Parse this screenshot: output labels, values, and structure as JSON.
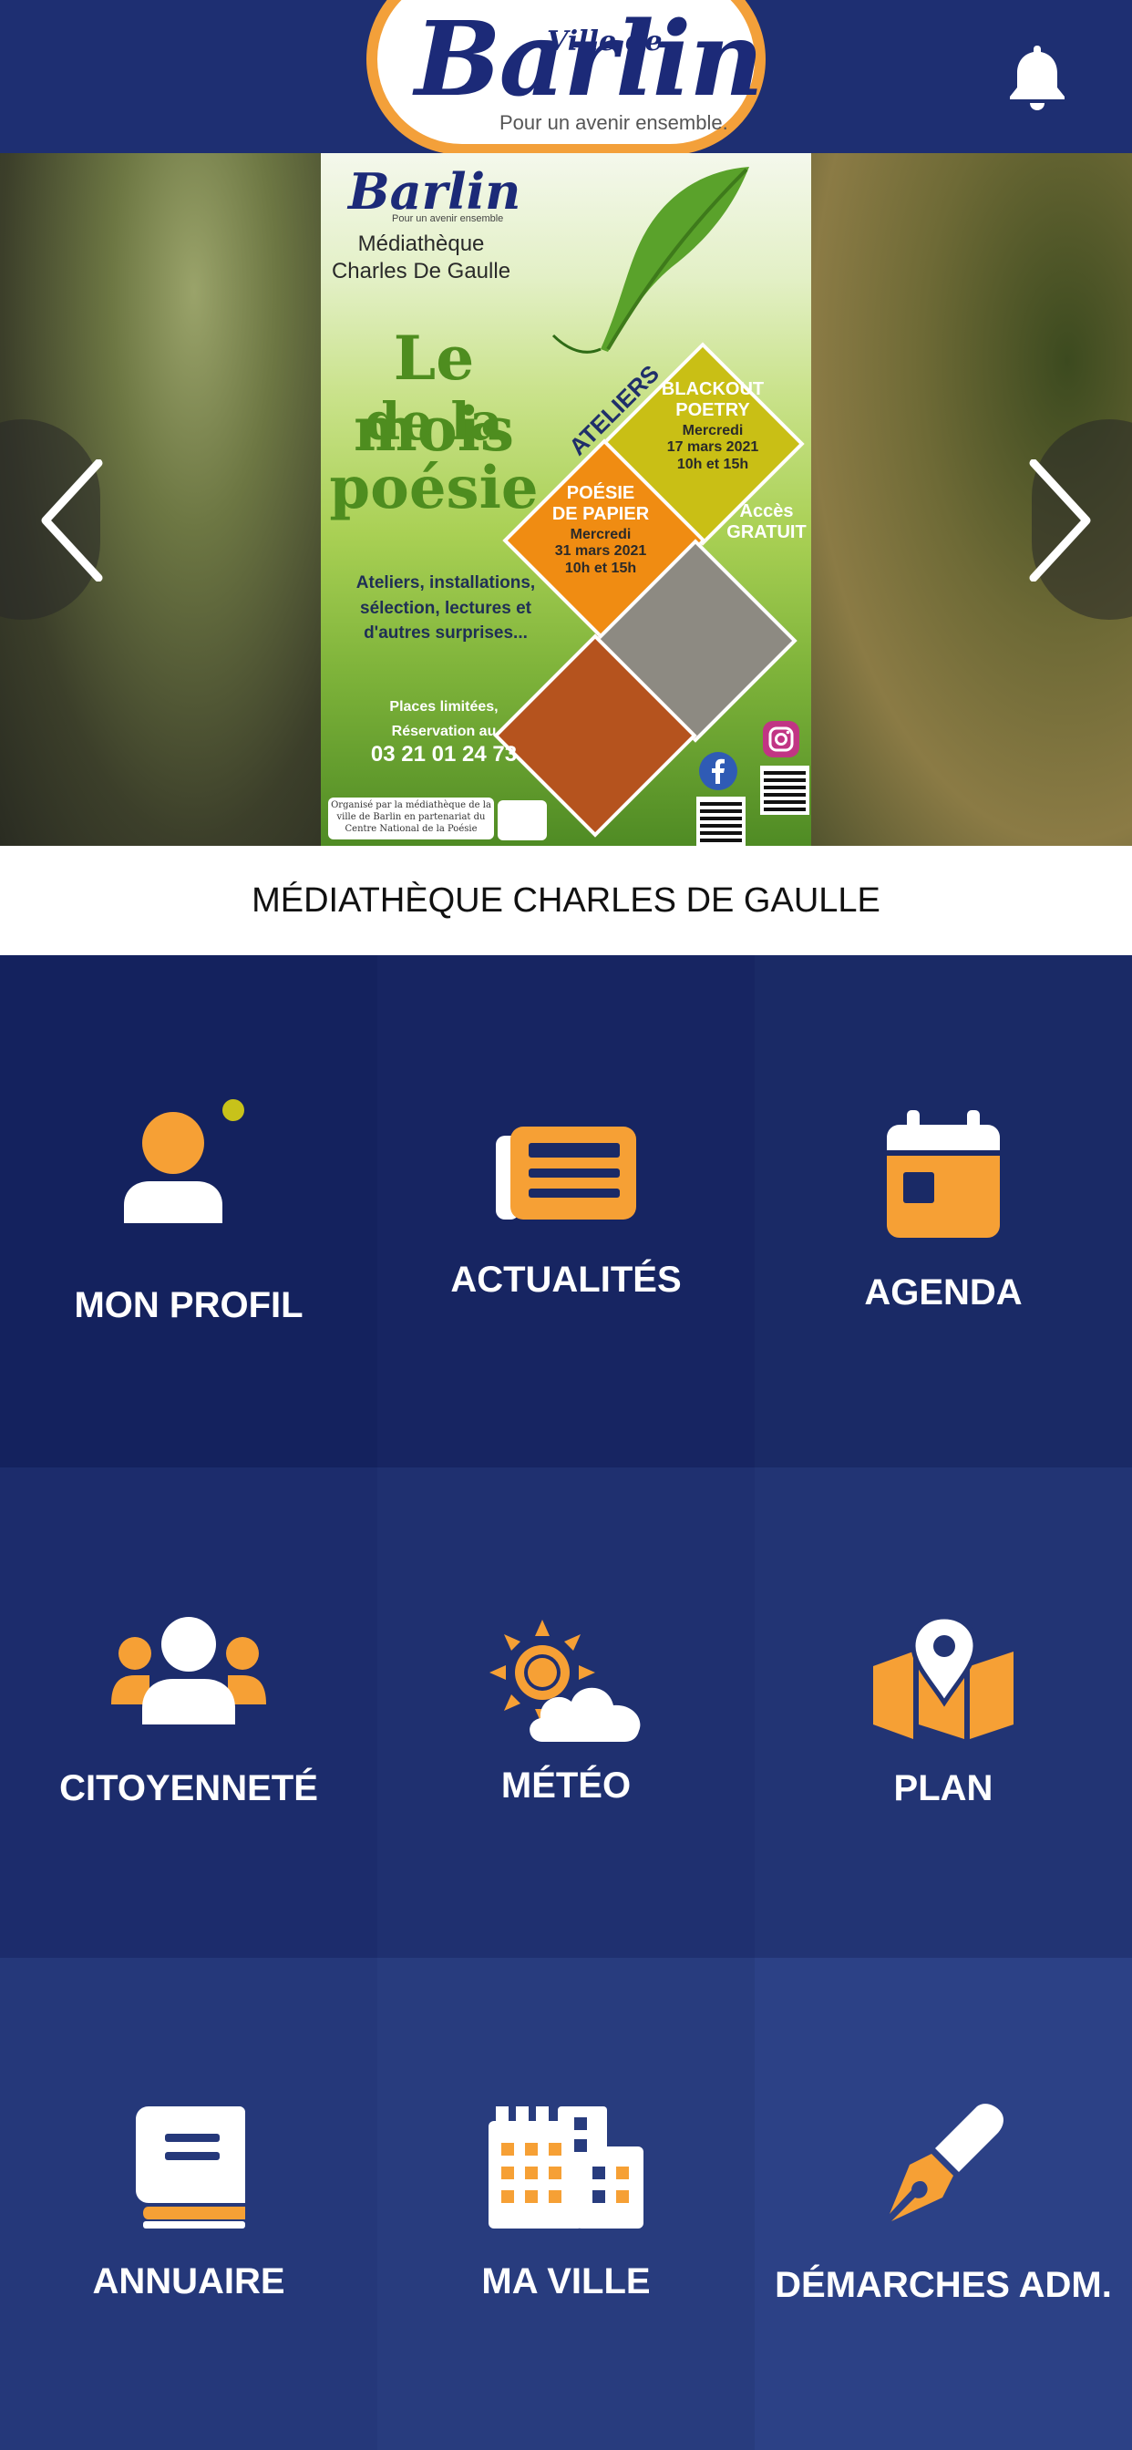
{
  "header": {
    "logo": {
      "ville_de": "Ville de",
      "name": "Barlin",
      "tagline": "Pour un avenir ensemble."
    },
    "notifications_icon": "bell-icon"
  },
  "carousel": {
    "poster": {
      "logo_name": "Barlin",
      "logo_tagline": "Pour un avenir ensemble",
      "venue_line1": "Médiathèque",
      "venue_line2": "Charles De Gaulle",
      "title_line1": "Le mois",
      "title_line2": "de la",
      "title_line3": "poésie",
      "ateliers": "ATELIERS",
      "event1": {
        "line1": "BLACKOUT",
        "line2": "POETRY",
        "line3": "Mercredi",
        "line4": "17 mars 2021",
        "line5": "10h et 15h"
      },
      "event2": {
        "line1": "POÉSIE",
        "line2": "DE PAPIER",
        "line3": "Mercredi",
        "line4": "31 mars 2021",
        "line5": "10h et 15h"
      },
      "access_line1": "Accès",
      "access_line2": "GRATUIT",
      "description": "Ateliers, installations, sélection, lectures et d'autres surprises...",
      "places_line1": "Places limitées,",
      "places_line2": "Réservation au",
      "phone": "03 21 01 24 73",
      "organizer": "Organisé par la médiathèque de la ville de Barlin en partenariat du Centre National de la Poésie"
    },
    "prev_icon": "chevron-left-icon",
    "next_icon": "chevron-right-icon",
    "caption": "MÉDIATHÈQUE CHARLES DE GAULLE"
  },
  "menu": {
    "tiles": [
      {
        "label": "MON PROFIL",
        "icon": "profile-icon"
      },
      {
        "label": "ACTUALITÉS",
        "icon": "newspaper-icon"
      },
      {
        "label": "AGENDA",
        "icon": "calendar-icon"
      },
      {
        "label": "CITOYENNETÉ",
        "icon": "users-icon"
      },
      {
        "label": "MÉTÉO",
        "icon": "weather-icon"
      },
      {
        "label": "PLAN",
        "icon": "map-icon"
      },
      {
        "label": "ANNUAIRE",
        "icon": "book-icon"
      },
      {
        "label": "MA VILLE",
        "icon": "city-icon"
      },
      {
        "label": "DÉMARCHES ADM.",
        "icon": "pen-icon"
      }
    ]
  },
  "colors": {
    "header_bg": "#1e2f72",
    "accent_orange": "#f6a035",
    "status_dot": "#c8c21a",
    "row1_tiles": [
      "#14225e",
      "#172562",
      "#1a2a66"
    ],
    "row2_tiles": [
      "#1c2c6c",
      "#1f3070",
      "#223474"
    ],
    "row3_tiles": [
      "#25387a",
      "#283c7e",
      "#2c4186"
    ]
  }
}
